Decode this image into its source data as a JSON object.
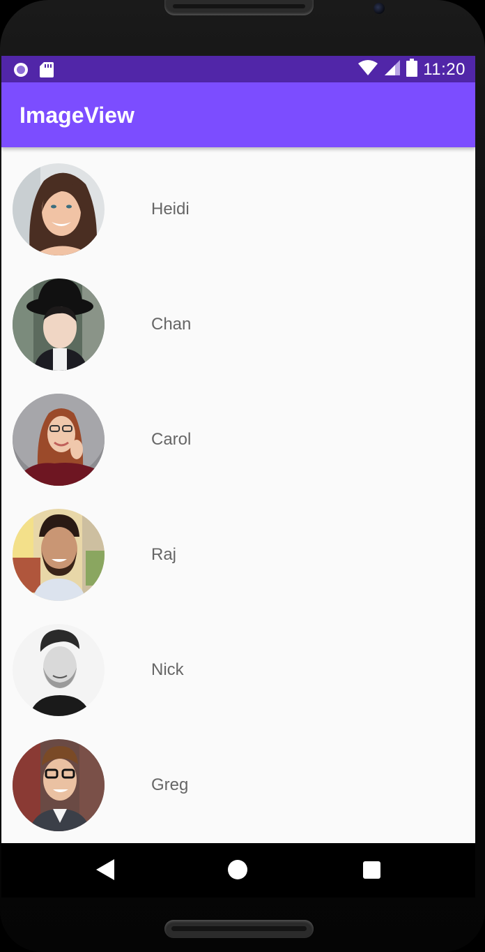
{
  "status_bar": {
    "time": "11:20",
    "left_icons": [
      "notification-circle-icon",
      "sd-card-icon"
    ],
    "right_icons": [
      "wifi-icon",
      "signal-icon",
      "battery-icon"
    ]
  },
  "app_bar": {
    "title": "ImageView"
  },
  "contacts": [
    {
      "name": "Heidi",
      "avatar": "avatar-heidi"
    },
    {
      "name": "Chan",
      "avatar": "avatar-chan"
    },
    {
      "name": "Carol",
      "avatar": "avatar-carol"
    },
    {
      "name": "Raj",
      "avatar": "avatar-raj"
    },
    {
      "name": "Nick",
      "avatar": "avatar-nick"
    },
    {
      "name": "Greg",
      "avatar": "avatar-greg"
    }
  ],
  "nav_bar": {
    "buttons": [
      "back-icon",
      "home-icon",
      "recents-icon"
    ]
  },
  "colors": {
    "status_bar": "#5126a8",
    "app_bar": "#7c4dff",
    "background": "#fafafa",
    "name_text": "#666666"
  }
}
